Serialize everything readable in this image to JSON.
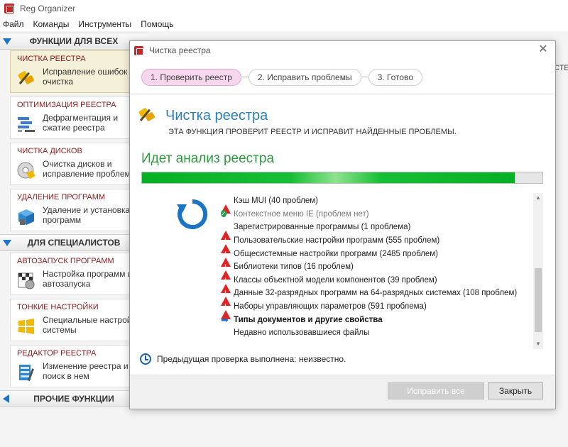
{
  "app": {
    "title": "Reg Organizer"
  },
  "menu": [
    "Файл",
    "Команды",
    "Инструменты",
    "Помощь"
  ],
  "sidebar": {
    "section_all": "ФУНКЦИИ ДЛЯ ВСЕХ",
    "section_pro": "ДЛЯ СПЕЦИАЛИСТОВ",
    "section_other": "ПРОЧИЕ ФУНКЦИИ",
    "tools": [
      {
        "title": "ЧИСТКА РЕЕСТРА",
        "desc": "Исправление ошибок\nочистка",
        "icon": "registry-clean-icon"
      },
      {
        "title": "ОПТИМИЗАЦИЯ РЕЕСТРА",
        "desc": "Дефрагментация и\nсжатие реестра",
        "icon": "registry-optimize-icon"
      },
      {
        "title": "ЧИСТКА ДИСКОВ",
        "desc": "Очистка дисков и\nисправление проблем",
        "icon": "disk-clean-icon"
      },
      {
        "title": "УДАЛЕНИЕ ПРОГРАММ",
        "desc": "Удаление и установка\nпрограмм",
        "icon": "uninstall-icon"
      },
      {
        "title": "АВТОЗАПУСК ПРОГРАММ",
        "desc": "Настройка программ и\nавтозапуска",
        "icon": "autorun-icon"
      },
      {
        "title": "ТОНКИЕ НАСТРОЙКИ",
        "desc": "Специальные настройки\nсистемы",
        "icon": "tweaks-icon"
      },
      {
        "title": "РЕДАКТОР РЕЕСТРА",
        "desc": "Изменение реестра и\nпоиск в нем",
        "icon": "registry-editor-icon"
      }
    ]
  },
  "background": {
    "edge_text": "СТЕ"
  },
  "dialog": {
    "title": "Чистка реестра",
    "steps": [
      "1. Проверить реестр",
      "2. Исправить проблемы",
      "3. Готово"
    ],
    "current_step": 0,
    "header_title": "Чистка реестра",
    "header_subtitle": "ЭТА ФУНКЦИЯ ПРОВЕРИТ РЕЕСТР И ИСПРАВИТ НАЙДЕННЫЕ ПРОБЛЕМЫ.",
    "analysis_title": "Идет анализ реестра",
    "progress": 0.93,
    "items": [
      {
        "status": "warning",
        "text": "Кэш MUI (40 проблем)"
      },
      {
        "status": "ok",
        "text": "Контекстное меню IE (проблем нет)"
      },
      {
        "status": "warning",
        "text": "Зарегистрированные программы (1 проблема)"
      },
      {
        "status": "warning",
        "text": "Пользовательские настройки программ (555 проблем)"
      },
      {
        "status": "warning",
        "text": "Общесистемные настройки программ (2485 проблем)"
      },
      {
        "status": "warning",
        "text": "Библиотеки типов (16 проблем)"
      },
      {
        "status": "warning",
        "text": "Классы объектной модели компонентов (39 проблем)"
      },
      {
        "status": "warning",
        "text": "Данные 32-разрядных программ на 64-разрядных системах (108 проблем)"
      },
      {
        "status": "warning",
        "text": "Наборы управляющих параметров (591 проблема)"
      },
      {
        "status": "current",
        "text": "Типы документов и другие свойства"
      },
      {
        "status": "pending",
        "text": "Недавно использовавшиеся файлы"
      }
    ],
    "previous_check": "Предыдущая проверка выполнена: неизвестно.",
    "fix_all_label": "Исправить все",
    "close_label": "Закрыть"
  },
  "colors": {
    "accent": "#2a7fb8",
    "analysis": "#2e9a3f",
    "progress": "#06b025",
    "warning": "#e02424",
    "ok": "#20a048",
    "tool_title": "#8a1818"
  }
}
